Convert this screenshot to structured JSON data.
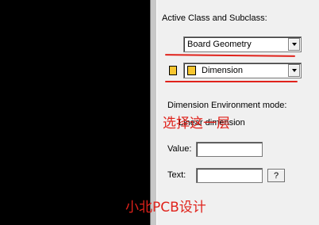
{
  "panel": {
    "active_class_heading": "Active Class and Subclass:",
    "class_dropdown": {
      "value": "Board Geometry"
    },
    "subclass_dropdown": {
      "value": "Dimension"
    },
    "dimension_env_label": "Dimension Environment mode:",
    "linear_dimension_label": "Linear dimension",
    "value_label": "Value:",
    "value_field": "",
    "text_label": "Text:",
    "text_field": "",
    "help_button": "?"
  },
  "annotations": {
    "choose_layer": "选择这一层",
    "watermark": "小北PCB设计"
  },
  "colors": {
    "annotation": "#e0221b",
    "subclass_swatch": "#f7c630",
    "panel_bg": "#f0f0f0",
    "canvas_bg": "#000000"
  }
}
